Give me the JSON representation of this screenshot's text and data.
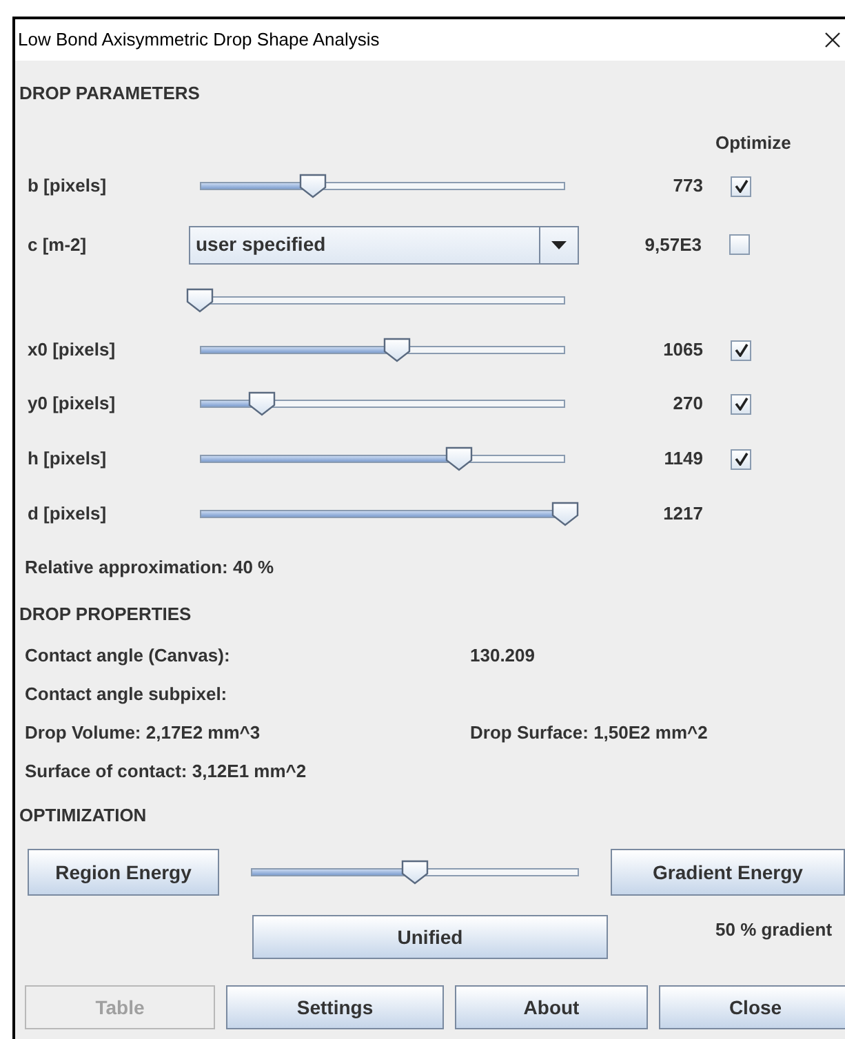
{
  "window": {
    "title": "Low Bond Axisymmetric Drop Shape Analysis"
  },
  "drop_parameters": {
    "heading": "DROP PARAMETERS",
    "optimize_header": "Optimize",
    "rows": [
      {
        "kind": "slider",
        "label": "b [pixels]",
        "level": 0.31,
        "value": "773",
        "optimize": true
      },
      {
        "kind": "combo",
        "label": "c [m-2]",
        "combo_value": "user specified",
        "value": "9,57E3",
        "optimize": false
      },
      {
        "kind": "slider",
        "level": 0
      },
      {
        "kind": "slider",
        "label": "x0 [pixels]",
        "level": 0.54,
        "value": "1065",
        "optimize": true
      },
      {
        "kind": "slider",
        "label": "y0 [pixels]",
        "level": 0.17,
        "value": "270",
        "optimize": true
      },
      {
        "kind": "slider",
        "label": "h [pixels]",
        "level": 0.71,
        "value": "1149",
        "optimize": true
      },
      {
        "kind": "slider",
        "label": "d [pixels]",
        "level": 1,
        "value": "1217"
      }
    ]
  },
  "relative_approximation": "Relative approximation: 40 %",
  "drop_properties": {
    "heading": "DROP PROPERTIES",
    "contact_angle_canvas": {
      "label": "Contact angle (Canvas):",
      "value": "130.209"
    },
    "contact_angle_subpixel": "Contact angle subpixel:",
    "drop_volume": "Drop Volume: 2,17E2 mm^3",
    "drop_surface": "Drop Surface: 1,50E2 mm^2",
    "surface_of_contact": "Surface of contact: 3,12E1 mm^2"
  },
  "optimization": {
    "heading": "OPTIMIZATION",
    "region_button": "Region Energy",
    "level": 0.5,
    "gradient_button": "Gradient Energy",
    "unified_button": "Unified",
    "gradient_share": "50 % gradient"
  },
  "buttons": [
    {
      "label": "Table",
      "disabled": true
    },
    {
      "label": "Settings",
      "disabled": false
    },
    {
      "label": "About",
      "disabled": false
    },
    {
      "label": "Close",
      "disabled": false
    }
  ]
}
